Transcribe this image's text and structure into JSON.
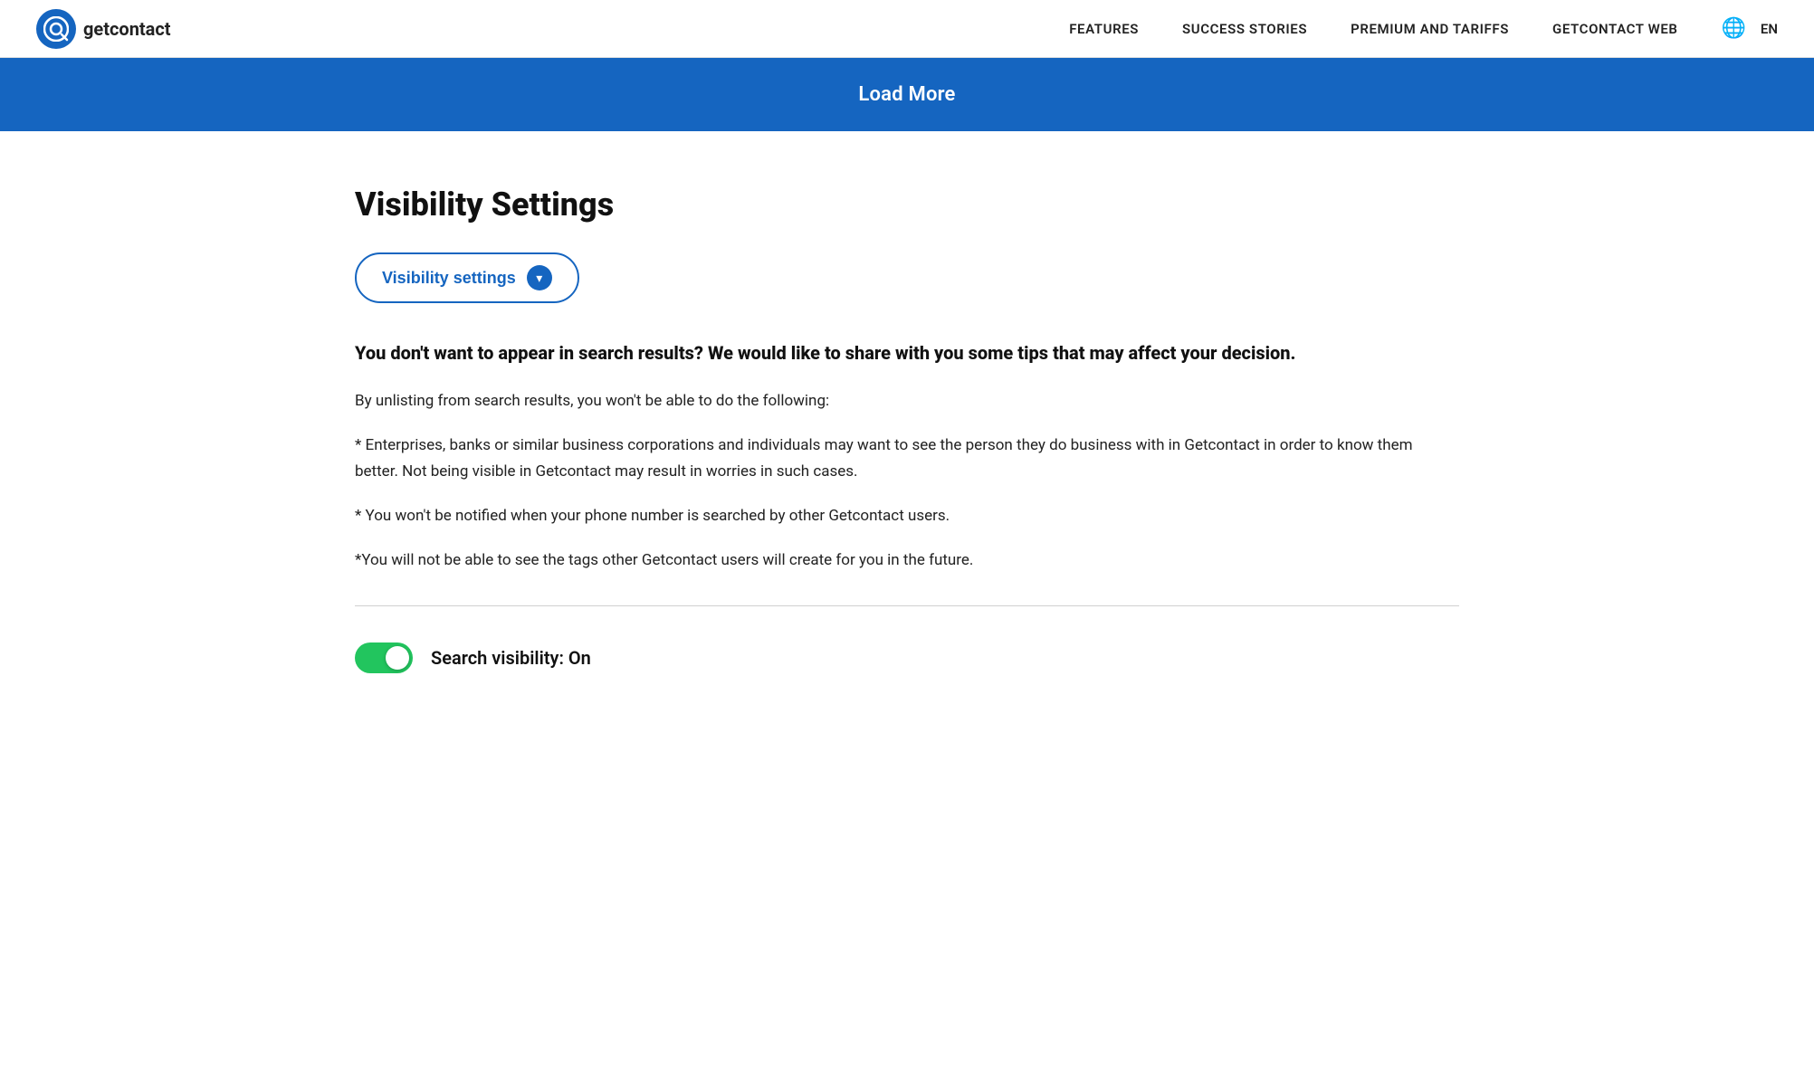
{
  "navbar": {
    "logo_text": "getcontact",
    "logo_icon": "Q",
    "links": [
      {
        "id": "features",
        "label": "FEATURES"
      },
      {
        "id": "success-stories",
        "label": "SUCCESS STORIES"
      },
      {
        "id": "premium-tariffs",
        "label": "PREMIUM AND TARIFFS"
      },
      {
        "id": "getcontact-web",
        "label": "GETCONTACT WEB"
      }
    ],
    "language": "EN"
  },
  "load_more_banner": {
    "label": "Load More"
  },
  "visibility_section": {
    "title": "Visibility Settings",
    "dropdown_label": "Visibility settings",
    "dropdown_chevron": "▾",
    "bold_paragraph": "You don't want to appear in search results? We would like to share with you some tips that may affect your decision.",
    "paragraphs": [
      "By unlisting from search results, you won't be able to do the following:",
      "* Enterprises, banks or similar business corporations and individuals may want to see the person they do business with in Getcontact in order to know them better. Not being visible in Getcontact may result in worries in such cases.",
      "* You won't be notified when your phone number is searched by other Getcontact users.",
      "*You will not be able to see the tags other Getcontact users will create for you in the future."
    ],
    "toggle_label": "Search visibility: On",
    "toggle_on": true
  }
}
